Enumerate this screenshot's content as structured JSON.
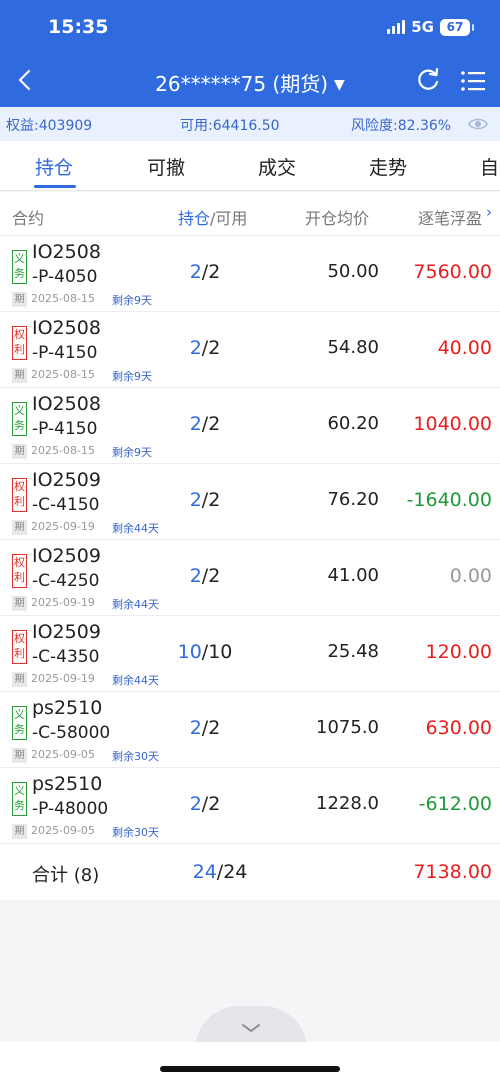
{
  "status": {
    "time": "15:35",
    "network": "5G",
    "battery": "67"
  },
  "nav": {
    "title": "26******75 (期货)",
    "caret": "▼"
  },
  "account": {
    "equity": "权益:403909",
    "available": "可用:64416.50",
    "risk": "风险度:82.36%"
  },
  "tabs": [
    "持仓",
    "可撤",
    "成交",
    "走势",
    "自"
  ],
  "columns": {
    "contract": "合约",
    "hold": "持仓",
    "avail": "/可用",
    "avg_price": "开仓均价",
    "pnl": "逐笔浮盈"
  },
  "rows": [
    {
      "badge": "义务",
      "type": "yiwu",
      "code1": "IO2508",
      "code2": "-P-4050",
      "qi": "期",
      "expiry": "2025-08-15",
      "remain": "剩余9天",
      "hold": "2",
      "avail": "/2",
      "price": "50.00",
      "pnl": "7560.00",
      "pnl_color": "red"
    },
    {
      "badge": "权利",
      "type": "quanli",
      "code1": "IO2508",
      "code2": "-P-4150",
      "qi": "期",
      "expiry": "2025-08-15",
      "remain": "剩余9天",
      "hold": "2",
      "avail": "/2",
      "price": "54.80",
      "pnl": "40.00",
      "pnl_color": "red"
    },
    {
      "badge": "义务",
      "type": "yiwu",
      "code1": "IO2508",
      "code2": "-P-4150",
      "qi": "期",
      "expiry": "2025-08-15",
      "remain": "剩余9天",
      "hold": "2",
      "avail": "/2",
      "price": "60.20",
      "pnl": "1040.00",
      "pnl_color": "red"
    },
    {
      "badge": "权利",
      "type": "quanli",
      "code1": "IO2509",
      "code2": "-C-4150",
      "qi": "期",
      "expiry": "2025-09-19",
      "remain": "剩余44天",
      "hold": "2",
      "avail": "/2",
      "price": "76.20",
      "pnl": "-1640.00",
      "pnl_color": "green"
    },
    {
      "badge": "权利",
      "type": "quanli",
      "code1": "IO2509",
      "code2": "-C-4250",
      "qi": "期",
      "expiry": "2025-09-19",
      "remain": "剩余44天",
      "hold": "2",
      "avail": "/2",
      "price": "41.00",
      "pnl": "0.00",
      "pnl_color": "gray"
    },
    {
      "badge": "权利",
      "type": "quanli",
      "code1": "IO2509",
      "code2": "-C-4350",
      "qi": "期",
      "expiry": "2025-09-19",
      "remain": "剩余44天",
      "hold": "10",
      "avail": "/10",
      "price": "25.48",
      "pnl": "120.00",
      "pnl_color": "red"
    },
    {
      "badge": "义务",
      "type": "yiwu",
      "code1": "ps2510",
      "code2": "-C-58000",
      "qi": "期",
      "expiry": "2025-09-05",
      "remain": "剩余30天",
      "hold": "2",
      "avail": "/2",
      "price": "1075.0",
      "pnl": "630.00",
      "pnl_color": "red"
    },
    {
      "badge": "义务",
      "type": "yiwu",
      "code1": "ps2510",
      "code2": "-P-48000",
      "qi": "期",
      "expiry": "2025-09-05",
      "remain": "剩余30天",
      "hold": "2",
      "avail": "/2",
      "price": "1228.0",
      "pnl": "-612.00",
      "pnl_color": "green"
    }
  ],
  "total": {
    "label": "合计 (8)",
    "hold": "24",
    "avail": "/24",
    "pnl": "7138.00"
  },
  "colors": {
    "brand": "#2f6bdf",
    "profit": "#e81e1e",
    "loss": "#1d9a3a"
  }
}
